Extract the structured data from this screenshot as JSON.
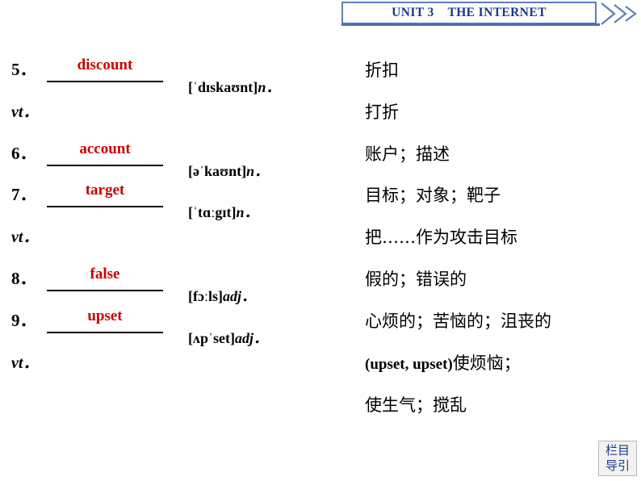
{
  "header": {
    "title": "UNIT 3    THE INTERNET",
    "accent_color": "#1a3a8f",
    "border_color": "#5b7fbd"
  },
  "badge": {
    "line1": "栏目",
    "line2": "导引",
    "color": "#1a3a8f"
  },
  "colors": {
    "answer_red": "#cc0000",
    "text_black": "#000000"
  },
  "entries": [
    {
      "number": "5．",
      "word": "discount",
      "phonetic": "[ˈdɪskaʊnt]",
      "pos": "n．",
      "chinese": "折扣",
      "has_blank": true
    },
    {
      "number": "vt．",
      "word": "",
      "phonetic": "",
      "pos": "",
      "chinese": "打折",
      "has_blank": false
    },
    {
      "number": "6．",
      "word": "account",
      "phonetic": "[əˈkaʊnt]",
      "pos": "n．",
      "chinese": "账户；描述",
      "has_blank": true
    },
    {
      "number": "7．",
      "word": "target",
      "phonetic": "[ˈtɑːgɪt]",
      "pos": "n．",
      "chinese": "目标；对象；靶子",
      "has_blank": true
    },
    {
      "number": "vt．",
      "word": "",
      "phonetic": "",
      "pos": "",
      "chinese": "把……作为攻击目标",
      "has_blank": false
    },
    {
      "number": "8．",
      "word": "false",
      "phonetic": "[fɔːls]",
      "pos": "adj．",
      "chinese": "假的；错误的",
      "has_blank": true
    },
    {
      "number": "9．",
      "word": "upset",
      "phonetic": "[ʌpˈset]",
      "pos": "adj．",
      "chinese": "心烦的；苦恼的；沮丧的",
      "has_blank": true
    },
    {
      "number": "vt．",
      "word": "",
      "phonetic": "",
      "pos": "",
      "chinese_latin": "(upset, upset)",
      "chinese": "使烦恼；",
      "has_blank": false
    },
    {
      "number": "",
      "word": "",
      "phonetic": "",
      "pos": "",
      "chinese": "使生气；搅乱",
      "has_blank": false
    }
  ]
}
